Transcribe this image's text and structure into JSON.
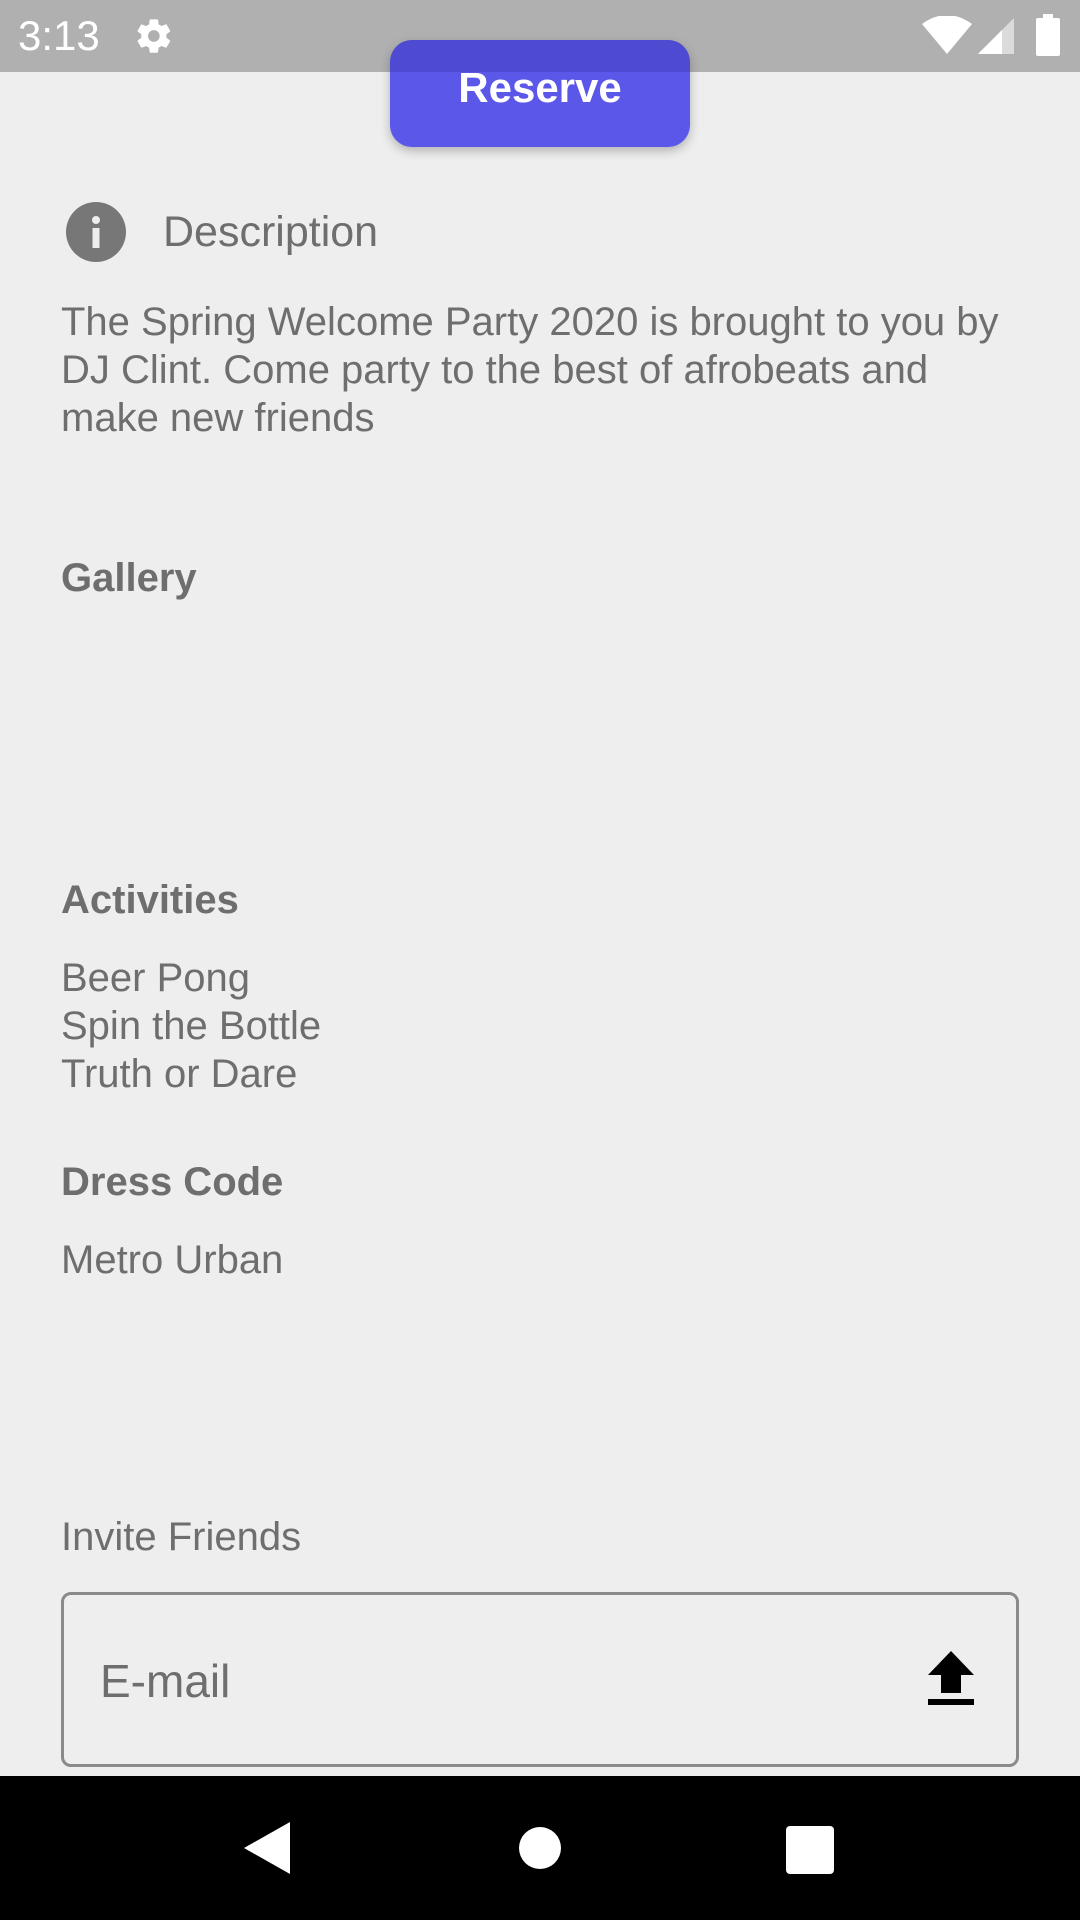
{
  "status_bar": {
    "time": "3:13",
    "icons": [
      "gear-icon",
      "wifi-icon",
      "signal-icon",
      "battery-icon"
    ]
  },
  "reserve_button": {
    "label": "Reserve",
    "color": "#5b57e8"
  },
  "description": {
    "icon": "info-icon",
    "title": "Description",
    "text": "The Spring Welcome Party 2020 is brought to you by DJ Clint. Come party to the best of afrobeats and make new friends"
  },
  "gallery": {
    "heading": "Gallery"
  },
  "activities": {
    "heading": "Activities",
    "items": [
      "Beer Pong",
      "Spin the Bottle",
      "Truth or Dare"
    ]
  },
  "dress_code": {
    "heading": "Dress Code",
    "value": "Metro Urban"
  },
  "invite": {
    "label": "Invite Friends",
    "email_placeholder": "E-mail",
    "email_value": "",
    "send_icon": "upload-icon"
  },
  "nav_bar": {
    "icons": [
      "back-icon",
      "home-icon",
      "recents-icon"
    ]
  }
}
